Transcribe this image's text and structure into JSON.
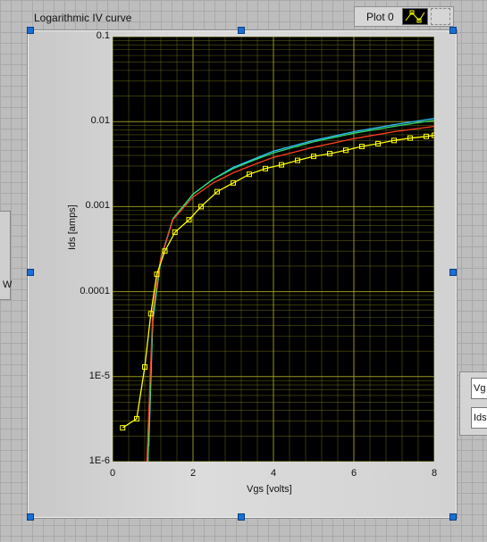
{
  "graph": {
    "title": "Logarithmic IV curve",
    "legend": {
      "plot_name": "Plot 0"
    }
  },
  "left_control": {
    "label": "W"
  },
  "right_controls": [
    {
      "label": "Vg"
    },
    {
      "label": "Ids"
    }
  ],
  "colors": {
    "plot_background": "#000000",
    "grid": "#9e9e20",
    "series": [
      "#ffff00",
      "#ff4020",
      "#30e070",
      "#30c0ff"
    ]
  },
  "chart_data": {
    "type": "line",
    "xlabel": "Vgs [volts]",
    "ylabel": "Ids [amps]",
    "xlim": [
      0,
      8
    ],
    "ylim": [
      1e-06,
      0.1
    ],
    "yscale": "log",
    "grid": true,
    "x_ticks": [
      "0",
      "2",
      "4",
      "6",
      "8"
    ],
    "y_ticks": [
      "1E-6",
      "1E-5",
      "0.0001",
      "0.001",
      "0.01",
      "0.1"
    ],
    "series": [
      {
        "color": "#ffff00",
        "marker": "square",
        "x": [
          0.25,
          0.6,
          0.8,
          0.95,
          1.1,
          1.3,
          1.55,
          1.9,
          2.2,
          2.6,
          3.0,
          3.4,
          3.8,
          4.2,
          4.6,
          5.0,
          5.4,
          5.8,
          6.2,
          6.6,
          7.0,
          7.4,
          7.8,
          8.0
        ],
        "y": [
          2.5e-06,
          3.2e-06,
          1.3e-05,
          5.5e-05,
          0.00016,
          0.0003,
          0.0005,
          0.0007,
          0.001,
          0.0015,
          0.0019,
          0.0024,
          0.0028,
          0.0031,
          0.0035,
          0.0039,
          0.0042,
          0.0046,
          0.0051,
          0.0055,
          0.006,
          0.0064,
          0.0067,
          0.0069
        ]
      },
      {
        "color": "#ff4020",
        "x": [
          0.85,
          1.0,
          1.2,
          1.5,
          2.0,
          2.5,
          3.0,
          3.5,
          4.0,
          5.0,
          6.0,
          7.0,
          8.0
        ],
        "y": [
          1e-06,
          6e-05,
          0.00025,
          0.0007,
          0.0013,
          0.0019,
          0.0025,
          0.0031,
          0.0038,
          0.005,
          0.0063,
          0.0076,
          0.0088
        ]
      },
      {
        "color": "#30e070",
        "x": [
          0.88,
          1.0,
          1.2,
          1.5,
          2.0,
          2.5,
          3.0,
          3.5,
          4.0,
          5.0,
          6.0,
          7.0,
          8.0
        ],
        "y": [
          1e-06,
          5e-05,
          0.00025,
          0.00072,
          0.0014,
          0.0021,
          0.0028,
          0.0035,
          0.0043,
          0.0058,
          0.0073,
          0.0088,
          0.0104
        ]
      },
      {
        "color": "#30c0ff",
        "x": [
          0.9,
          1.0,
          1.2,
          1.5,
          2.0,
          2.5,
          3.0,
          3.5,
          4.0,
          5.0,
          6.0,
          7.0,
          8.0
        ],
        "y": [
          1.5e-06,
          4.5e-05,
          0.00024,
          0.00071,
          0.0014,
          0.0021,
          0.0029,
          0.0036,
          0.0045,
          0.006,
          0.0076,
          0.0092,
          0.0109
        ]
      }
    ]
  }
}
